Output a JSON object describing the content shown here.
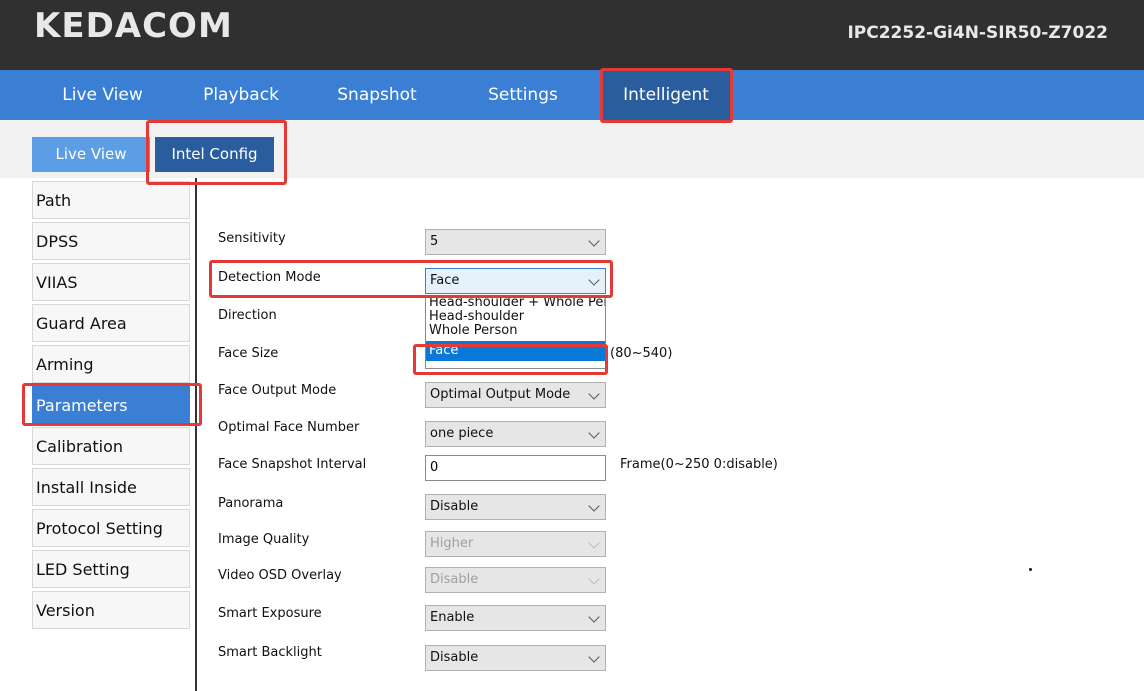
{
  "header": {
    "logo": "KEDACOM",
    "model": "IPC2252-Gi4N-SIR50-Z7022"
  },
  "nav": {
    "tabs": [
      {
        "label": "Live View"
      },
      {
        "label": "Playback"
      },
      {
        "label": "Snapshot"
      },
      {
        "label": "Settings"
      },
      {
        "label": "Intelligent"
      }
    ],
    "active": "Intelligent"
  },
  "subtabs": [
    {
      "label": "Live View"
    },
    {
      "label": "Intel Config"
    }
  ],
  "sidebar": {
    "items": [
      {
        "label": "Path"
      },
      {
        "label": "DPSS"
      },
      {
        "label": "VIIAS"
      },
      {
        "label": "Guard Area"
      },
      {
        "label": "Arming"
      },
      {
        "label": "Parameters"
      },
      {
        "label": "Calibration"
      },
      {
        "label": "Install Inside"
      },
      {
        "label": "Protocol Setting"
      },
      {
        "label": "LED Setting"
      },
      {
        "label": "Version"
      }
    ],
    "active": "Parameters"
  },
  "form": {
    "sensitivity": {
      "label": "Sensitivity",
      "value": "5"
    },
    "detection_mode": {
      "label": "Detection Mode",
      "value": "Face",
      "options": [
        "Head-shoulder + Whole Person",
        "Head-shoulder",
        "Whole Person",
        "Face"
      ]
    },
    "direction": {
      "label": "Direction"
    },
    "face_size": {
      "label": "Face Size",
      "hint": "(80~540)"
    },
    "face_output_mode": {
      "label": "Face Output Mode",
      "value": "Optimal Output Mode"
    },
    "optimal_face_number": {
      "label": "Optimal Face Number",
      "value": "one piece"
    },
    "face_snapshot_interval": {
      "label": "Face Snapshot Interval",
      "value": "0",
      "hint": "Frame(0~250 0:disable)"
    },
    "panorama": {
      "label": "Panorama",
      "value": "Disable"
    },
    "image_quality": {
      "label": "Image Quality",
      "value": "Higher"
    },
    "video_osd_overlay": {
      "label": "Video OSD Overlay",
      "value": "Disable"
    },
    "smart_exposure": {
      "label": "Smart Exposure",
      "value": "Enable"
    },
    "smart_backlight": {
      "label": "Smart Backlight",
      "value": "Disable"
    }
  },
  "colors": {
    "topbar": "#303030",
    "nav": "#3a7fd4",
    "nav_active": "#2a5d9e",
    "highlight": "#e53935",
    "selected_option": "#0a78d7"
  }
}
